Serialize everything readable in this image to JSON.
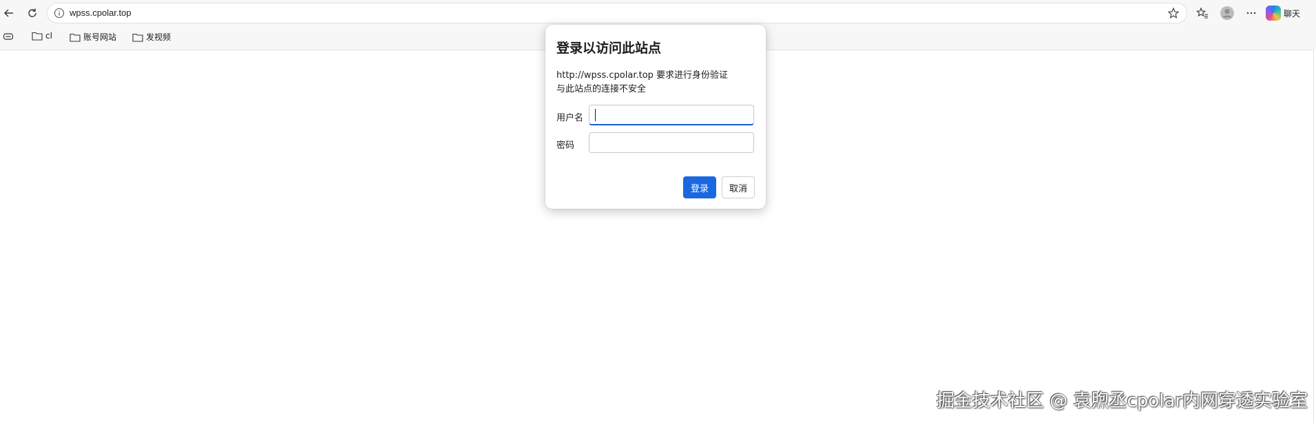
{
  "browser": {
    "url": "wpss.cpolar.top",
    "chat_label": "聊天"
  },
  "icons": {
    "back": "back-arrow-icon",
    "refresh": "refresh-icon",
    "info": "info-icon",
    "star": "star-outline-icon",
    "favorites": "favorites-icon",
    "profile": "profile-icon",
    "more": "more-dots-icon",
    "copilot": "copilot-icon",
    "sidebar": "sidebar-toggle-icon",
    "folder": "folder-icon"
  },
  "bookmarks": [
    {
      "label": "cl"
    },
    {
      "label": "账号网站"
    },
    {
      "label": "发视频"
    }
  ],
  "dialog": {
    "title": "登录以访问此站点",
    "message_line1": "http://wpss.cpolar.top 要求进行身份验证",
    "message_line2": "与此站点的连接不安全",
    "username_label": "用户名",
    "username_value": "",
    "password_label": "密码",
    "password_value": "",
    "login_button": "登录",
    "cancel_button": "取消"
  },
  "colors": {
    "primary_button": "#1a68e0",
    "focus_underline": "#1a5bd1"
  },
  "watermark": "掘金技术社区 @ 袁煦丞cpolar内网穿透实验室"
}
